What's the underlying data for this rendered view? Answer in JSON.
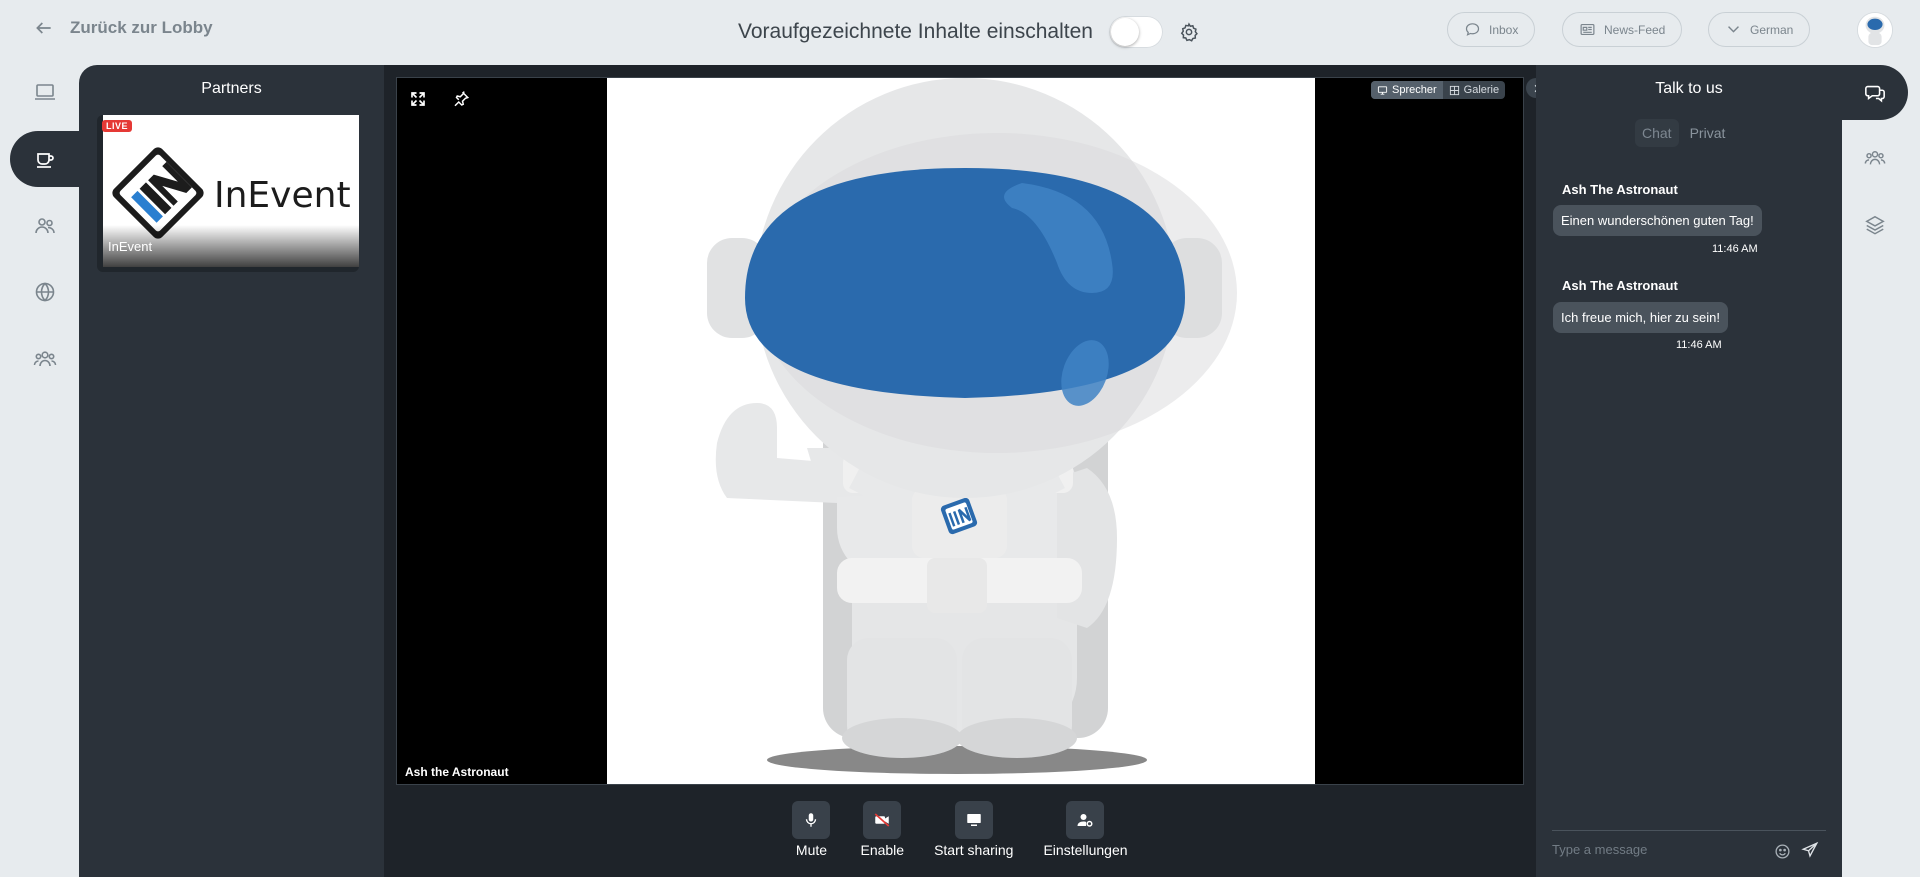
{
  "topbar": {
    "back_label": "Zurück zur Lobby",
    "center_title": "Voraufgezeichnete Inhalte einschalten",
    "inbox_label": "Inbox",
    "newsfeed_label": "News-Feed",
    "language_label": "German"
  },
  "left_rail": {
    "icons": [
      "laptop-icon",
      "coffee-cup-icon",
      "people-icon",
      "globe-icon",
      "group-icon"
    ],
    "active": "coffee-cup-icon"
  },
  "partners": {
    "title": "Partners",
    "items": [
      {
        "name": "InEvent",
        "badge": "LIVE",
        "logo_text": "InEvent"
      }
    ]
  },
  "stage": {
    "view_speaker_label": "Sprecher",
    "view_gallery_label": "Galerie",
    "speaker_name": "Ash the Astronaut"
  },
  "controls": {
    "mute_label": "Mute",
    "enable_label": "Enable",
    "share_label": "Start sharing",
    "settings_label": "Einstellungen"
  },
  "chat": {
    "title": "Talk to us",
    "tabs": [
      "Chat",
      "Privat"
    ],
    "messages": [
      {
        "author": "Ash The Astronaut",
        "text": "Einen wunderschönen guten Tag!",
        "time": "11:46 AM"
      },
      {
        "author": "Ash The Astronaut",
        "text": "Ich freue mich, hier zu sein!",
        "time": "11:46 AM"
      }
    ],
    "input_placeholder": "Type a message"
  },
  "colors": {
    "background": "#e7ebee",
    "panel": "#2b323a",
    "stage": "#1e2329",
    "helmet_blue": "#2a6aad",
    "live_red": "#e53935"
  }
}
